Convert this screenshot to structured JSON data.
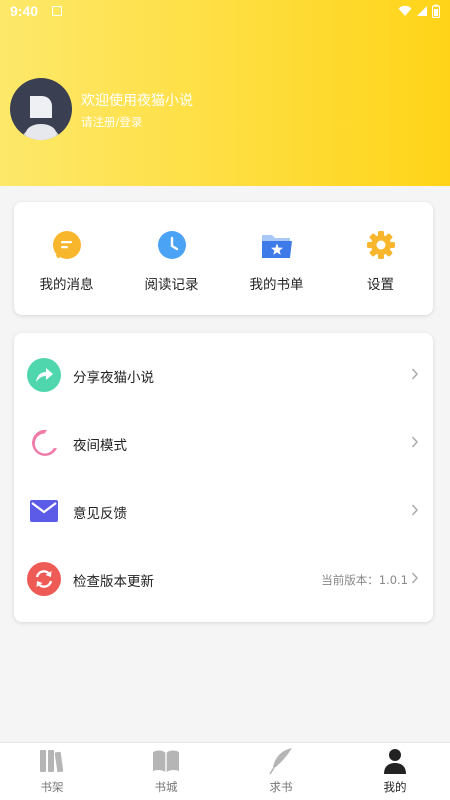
{
  "status_bar": {
    "time": "9:40"
  },
  "profile": {
    "title": "欢迎使用夜猫小说",
    "subtitle": "请注册/登录"
  },
  "quick_actions": [
    {
      "label": "我的消息",
      "icon": "message-icon",
      "color": "#f8b62d"
    },
    {
      "label": "阅读记录",
      "icon": "clock-icon",
      "color": "#4aa3f5"
    },
    {
      "label": "我的书单",
      "icon": "folder-star-icon",
      "color": "#3e7be8"
    },
    {
      "label": "设置",
      "icon": "gear-icon",
      "color": "#f8b62d"
    }
  ],
  "menu": [
    {
      "label": "分享夜猫小说",
      "icon": "share-icon",
      "color": "#4fd6ad",
      "value": ""
    },
    {
      "label": "夜间模式",
      "icon": "moon-icon",
      "color": "#f07aa6",
      "value": ""
    },
    {
      "label": "意见反馈",
      "icon": "mail-icon",
      "color": "#5c5be8",
      "value": ""
    },
    {
      "label": "检查版本更新",
      "icon": "refresh-icon",
      "color": "#ee5b56",
      "value": "当前版本：1.0.1"
    }
  ],
  "bottom_nav": [
    {
      "label": "书架",
      "icon": "bookshelf-icon",
      "active": false
    },
    {
      "label": "书城",
      "icon": "book-open-icon",
      "active": false
    },
    {
      "label": "求书",
      "icon": "feather-icon",
      "active": false
    },
    {
      "label": "我的",
      "icon": "person-icon",
      "active": true
    }
  ],
  "colors": {
    "header_gradient_start": "#fde86a",
    "header_gradient_end": "#ffd418",
    "inactive_icon": "#b5b5b5",
    "active_icon": "#222222"
  }
}
